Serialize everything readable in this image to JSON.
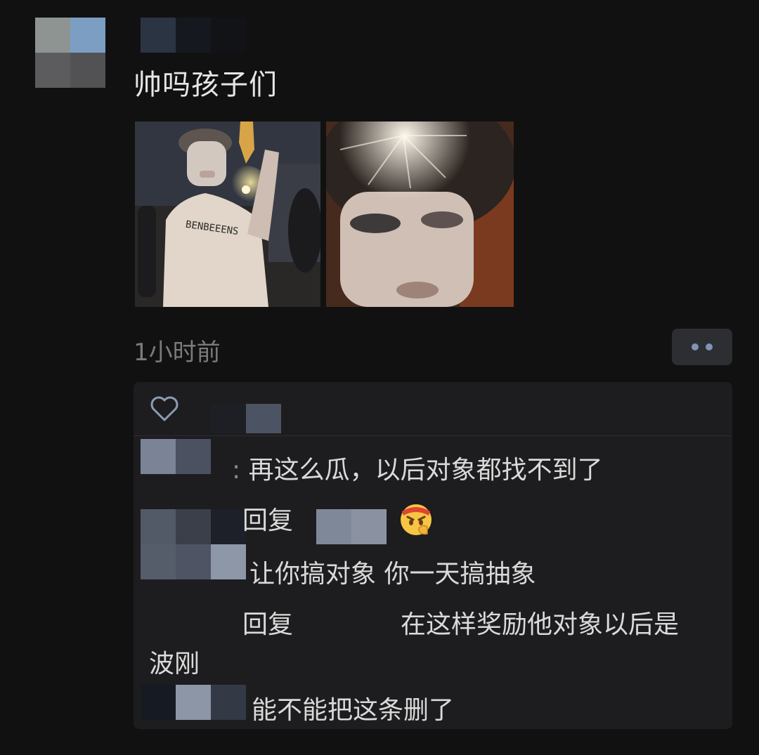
{
  "post": {
    "text": "帅吗孩子们",
    "time": "1小时前",
    "shirt_text": "BENBEEENS"
  },
  "comments": [
    {
      "sep": ":",
      "text": "再这么瓜，以后对象都找不到了"
    },
    {
      "reply_prefix": "回复",
      "text_after": "",
      "emoji": "angry-face-emoji"
    },
    {
      "text": "让你搞对象 你一天搞抽象"
    },
    {
      "reply_prefix": "回复",
      "text": "在这样奖励他对象以后是"
    },
    {
      "text": "波刚"
    },
    {
      "text": "能不能把这条删了"
    }
  ],
  "colors": {
    "background": "#111111",
    "panel": "#1d1d1f",
    "accent": "#7e93b6"
  },
  "icons": {
    "like": "heart-outline-icon",
    "more": "two-dots-icon"
  }
}
